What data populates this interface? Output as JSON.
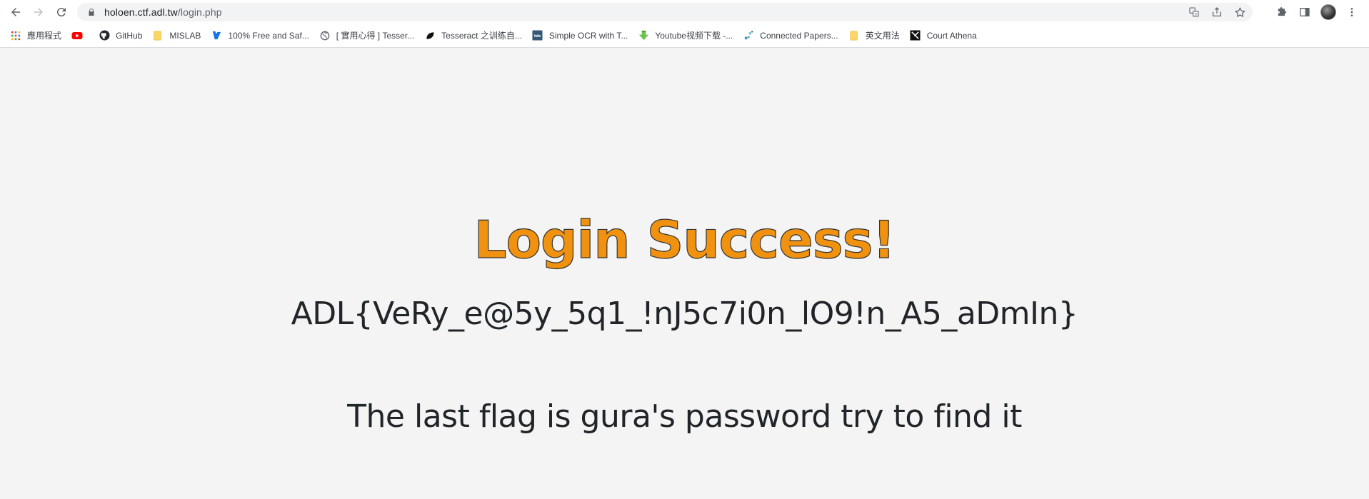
{
  "browser": {
    "url_host": "holoen.ctf.adl.tw",
    "url_path": "/login.php"
  },
  "bookmarks": [
    {
      "label": "應用程式",
      "icon": "apps-grid-icon"
    },
    {
      "label": "",
      "icon": "youtube-icon"
    },
    {
      "label": "GitHub",
      "icon": "github-icon"
    },
    {
      "label": "MISLAB",
      "icon": "folder-icon"
    },
    {
      "label": "100% Free and Saf...",
      "icon": "bookmark-site-icon"
    },
    {
      "label": "[ 實用心得 ] Tesser...",
      "icon": "globe-icon"
    },
    {
      "label": "Tesseract 之训练自...",
      "icon": "leaf-icon"
    },
    {
      "label": "Simple OCR with T...",
      "icon": "tds-icon"
    },
    {
      "label": "Youtube视频下载 -...",
      "icon": "download-arrow-icon"
    },
    {
      "label": "Connected Papers...",
      "icon": "connected-papers-icon"
    },
    {
      "label": "英文用法",
      "icon": "folder-icon"
    },
    {
      "label": "Court Athena",
      "icon": "court-athena-icon"
    }
  ],
  "page": {
    "title": "Login Success!",
    "flag": "ADL{VeRy_e@5y_5q1_!nJ5c7i0n_lO9!n_A5_aDmIn}",
    "hint": "The last flag is gura's password try to find it"
  },
  "colors": {
    "title": "#f0920f",
    "text": "#212529",
    "background": "#f4f4f4"
  }
}
